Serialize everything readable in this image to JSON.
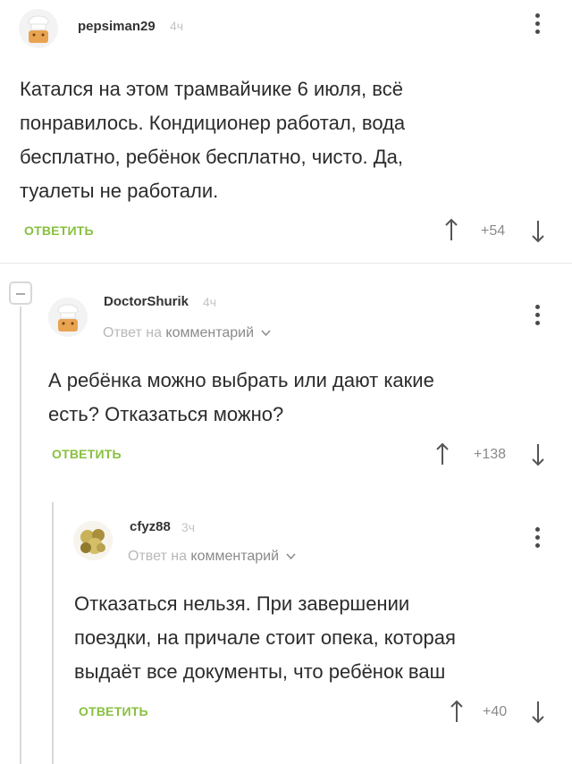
{
  "comments": [
    {
      "username": "pepsiman29",
      "time": "4ч",
      "text_lines": [
        "Катался на этом трамвайчике 6 июля, всё",
        "понравилось. Кондиционер работал, вода",
        "бесплатно, ребёнок бесплатно, чисто. Да,",
        "туалеты не работали."
      ],
      "reply_label": "ОТВЕТИТЬ",
      "score": "+54"
    },
    {
      "username": "DoctorShurik",
      "time": "4ч",
      "reply_to_prefix": "Ответ на",
      "reply_to_target": "комментарий",
      "text_lines": [
        "А ребёнка можно выбрать или дают какие",
        "есть? Отказаться можно?"
      ],
      "reply_label": "ОТВЕТИТЬ",
      "score": "+138"
    },
    {
      "username": "cfyz88",
      "time": "3ч",
      "reply_to_prefix": "Ответ на",
      "reply_to_target": "комментарий",
      "text_lines": [
        "Отказаться нельзя. При завершении",
        "поездки, на причале стоит опека, которая",
        "выдаёт все документы, что ребёнок ваш"
      ],
      "reply_label": "ОТВЕТИТЬ",
      "score": "+40"
    }
  ],
  "colors": {
    "accent": "#88c03f",
    "muted": "#8a8a8a",
    "thread_line": "#d8d8d8"
  },
  "icons": [
    "chef-avatar-icon",
    "kebab-menu-icon",
    "upvote-arrow-icon",
    "downvote-arrow-icon",
    "chevron-down-icon",
    "collapse-thread-icon"
  ]
}
